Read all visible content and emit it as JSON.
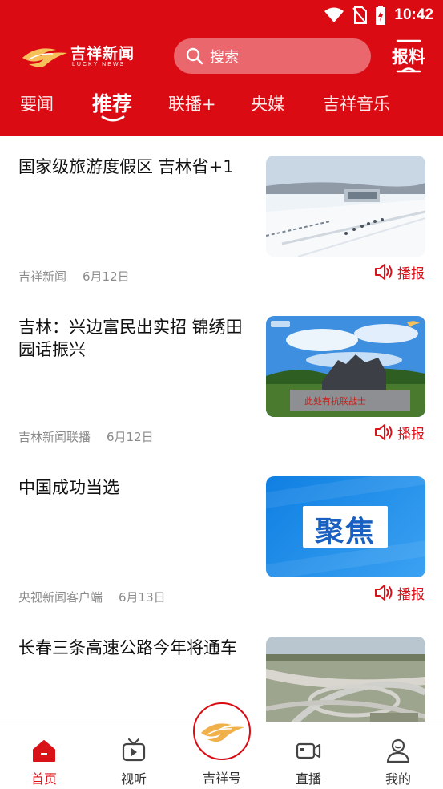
{
  "status_bar": {
    "time": "10:42"
  },
  "header": {
    "logo_text": "吉祥新闻",
    "logo_subtext": "LUCKY NEWS",
    "search_placeholder": "搜索",
    "report_label": "报料"
  },
  "tabs": [
    {
      "label": "要闻"
    },
    {
      "label": "推荐",
      "active": true
    },
    {
      "label": "联播+"
    },
    {
      "label": "央媒"
    },
    {
      "label": "吉祥音乐"
    }
  ],
  "feed": [
    {
      "title": "国家级旅游度假区 吉林省+1",
      "source": "吉祥新闻",
      "date": "6月12日",
      "action": "播报",
      "image": "snow-resort"
    },
    {
      "title": "吉林：兴边富民出实招 锦绣田园话振兴",
      "source": "吉林新闻联播",
      "date": "6月12日",
      "action": "播报",
      "image": "monument",
      "image_caption": "此处有抗联战士"
    },
    {
      "title": "中国成功当选",
      "source": "央视新闻客户端",
      "date": "6月13日",
      "action": "播报",
      "image": "focus-banner",
      "image_text": "聚焦"
    },
    {
      "title": "长春三条高速公路今年将通车",
      "image": "highway"
    }
  ],
  "bottom_nav": [
    {
      "label": "首页",
      "icon": "home-icon",
      "active": true
    },
    {
      "label": "视听",
      "icon": "tv-icon"
    },
    {
      "label": "吉祥号",
      "icon": "lucky-logo-icon"
    },
    {
      "label": "直播",
      "icon": "video-camera-icon"
    },
    {
      "label": "我的",
      "icon": "user-icon"
    }
  ],
  "colors": {
    "brand_red": "#db0b14",
    "accent_red": "#d9121a"
  }
}
